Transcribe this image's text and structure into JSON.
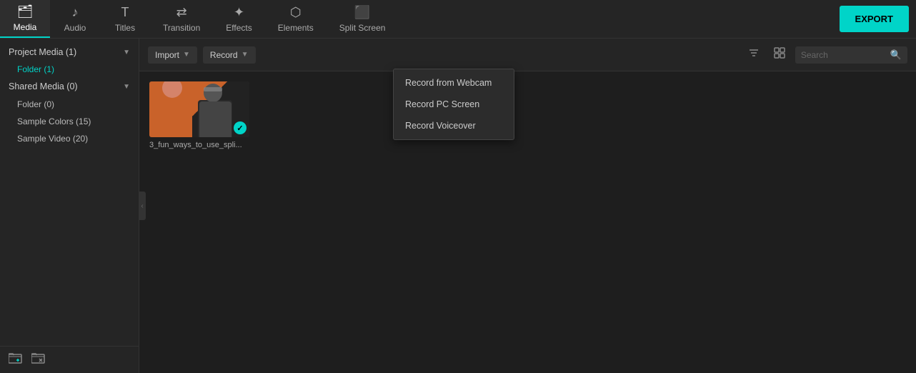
{
  "topNav": {
    "items": [
      {
        "id": "media",
        "label": "Media",
        "icon": "🗂",
        "active": true
      },
      {
        "id": "audio",
        "label": "Audio",
        "icon": "♪",
        "active": false
      },
      {
        "id": "titles",
        "label": "Titles",
        "icon": "T",
        "active": false
      },
      {
        "id": "transition",
        "label": "Transition",
        "icon": "⇄",
        "active": false
      },
      {
        "id": "effects",
        "label": "Effects",
        "icon": "✦",
        "active": false
      },
      {
        "id": "elements",
        "label": "Elements",
        "icon": "⬡",
        "active": false
      },
      {
        "id": "splitscreen",
        "label": "Split Screen",
        "icon": "⬛",
        "active": false
      }
    ],
    "exportLabel": "EXPORT"
  },
  "sidebar": {
    "sections": [
      {
        "label": "Project Media (1)",
        "expanded": true,
        "subItems": [
          {
            "label": "Folder (1)",
            "highlighted": true
          }
        ]
      },
      {
        "label": "Shared Media (0)",
        "expanded": true,
        "subItems": [
          {
            "label": "Folder (0)",
            "highlighted": false
          }
        ]
      }
    ],
    "plainItems": [
      {
        "label": "Sample Colors (15)"
      },
      {
        "label": "Sample Video (20)"
      }
    ],
    "footerIcons": [
      {
        "id": "new-folder",
        "icon": "📁+"
      },
      {
        "id": "delete-folder",
        "icon": "📁✕"
      }
    ]
  },
  "toolbar": {
    "importLabel": "Import",
    "recordLabel": "Record",
    "filterIcon": "⚙",
    "gridIcon": "⊞",
    "searchPlaceholder": "Search"
  },
  "dropdown": {
    "visible": true,
    "items": [
      {
        "id": "record-webcam",
        "label": "Record from Webcam"
      },
      {
        "id": "record-screen",
        "label": "Record PC Screen"
      },
      {
        "id": "record-voiceover",
        "label": "Record Voiceover"
      }
    ]
  },
  "mediaItems": [
    {
      "id": "media-1",
      "label": "3_fun_ways_to_use_spli...",
      "checked": true
    }
  ]
}
